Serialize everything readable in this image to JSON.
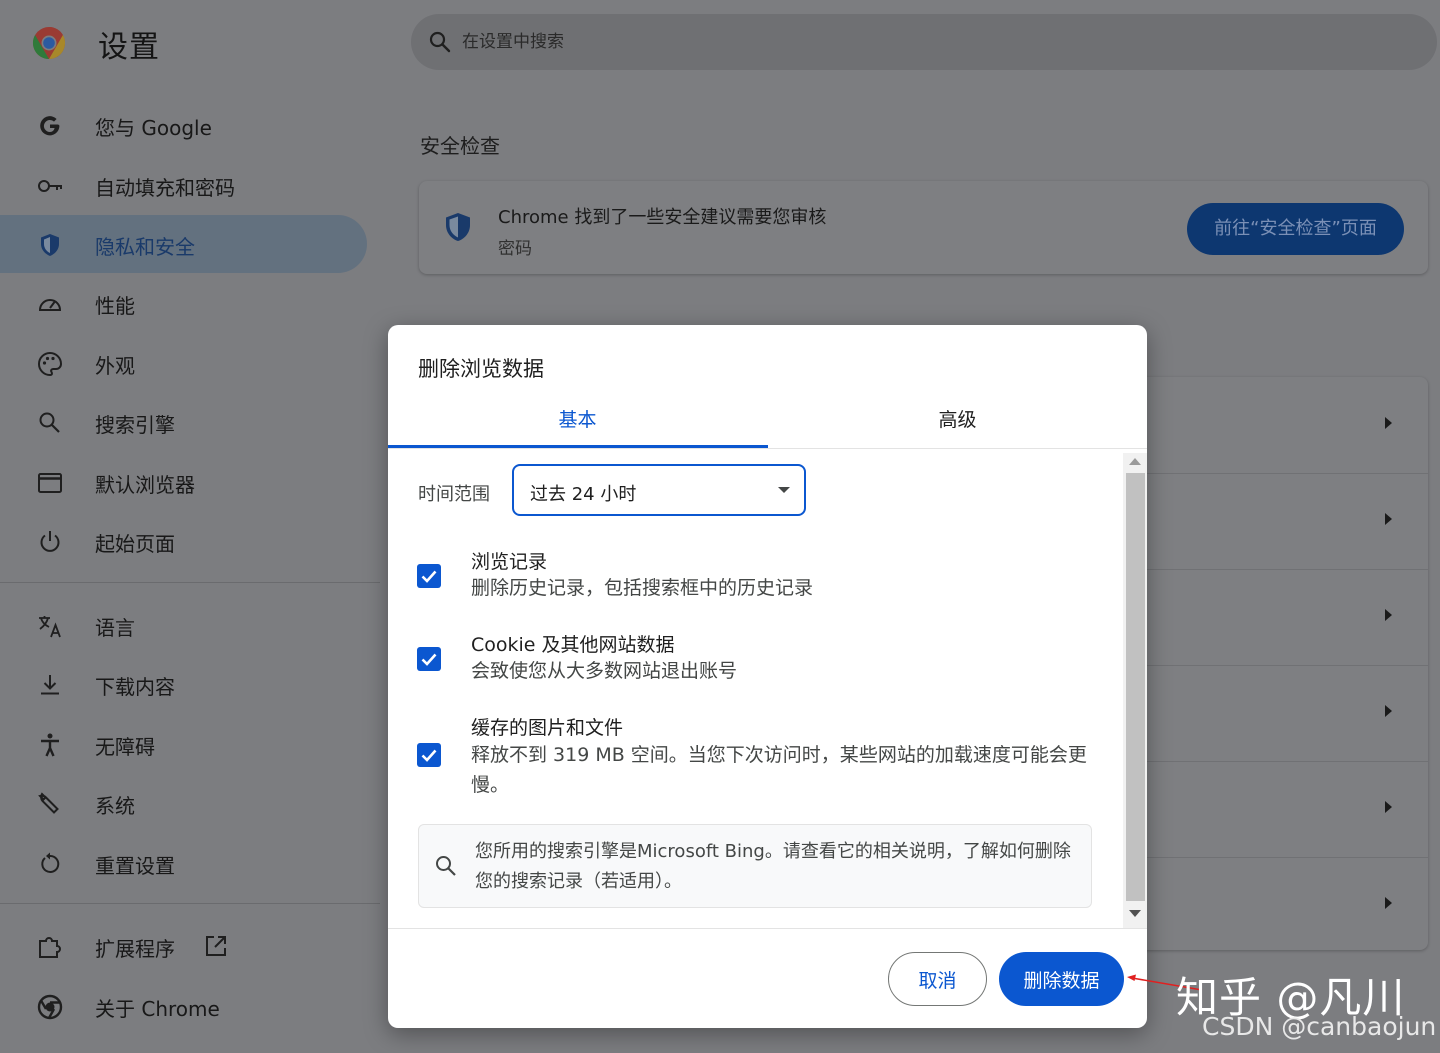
{
  "header": {
    "title": "设置",
    "search_placeholder": "在设置中搜索"
  },
  "sidebar": {
    "items": [
      {
        "label": "您与 Google",
        "icon": "google-icon"
      },
      {
        "label": "自动填充和密码",
        "icon": "key-icon"
      },
      {
        "label": "隐私和安全",
        "icon": "shield-icon",
        "active": true
      },
      {
        "label": "性能",
        "icon": "gauge-icon"
      },
      {
        "label": "外观",
        "icon": "palette-icon"
      },
      {
        "label": "搜索引擎",
        "icon": "search-icon"
      },
      {
        "label": "默认浏览器",
        "icon": "browser-window-icon"
      },
      {
        "label": "起始页面",
        "icon": "power-icon"
      },
      {
        "label": "语言",
        "icon": "translate-icon"
      },
      {
        "label": "下载内容",
        "icon": "download-icon"
      },
      {
        "label": "无障碍",
        "icon": "accessibility-icon"
      },
      {
        "label": "系统",
        "icon": "wrench-icon"
      },
      {
        "label": "重置设置",
        "icon": "reset-icon"
      },
      {
        "label": "扩展程序",
        "icon": "puzzle-icon"
      },
      {
        "label": "关于 Chrome",
        "icon": "chrome-icon"
      }
    ]
  },
  "main": {
    "section_title": "安全检查",
    "safety_card": {
      "title": "Chrome 找到了一些安全建议需要您审核",
      "subtitle": "密码",
      "button_label": "前往“安全检查”页面"
    }
  },
  "dialog": {
    "title": "删除浏览数据",
    "tabs": [
      {
        "label": "基本",
        "selected": true
      },
      {
        "label": "高级",
        "selected": false
      }
    ],
    "time_range": {
      "label": "时间范围",
      "value": "过去 24 小时"
    },
    "options": [
      {
        "title": "浏览记录",
        "description": "删除历史记录，包括搜索框中的历史记录",
        "checked": true
      },
      {
        "title": "Cookie 及其他网站数据",
        "description": "会致使您从大多数网站退出账号",
        "checked": true
      },
      {
        "title": "缓存的图片和文件",
        "description": "释放不到 319 MB 空间。当您下次访问时，某些网站的加载速度可能会更慢。",
        "checked": true
      }
    ],
    "info_text": "您所用的搜索引擎是Microsoft Bing。请查看它的相关说明，了解如何删除您的搜索记录（若适用）。",
    "cancel_label": "取消",
    "delete_label": "删除数据"
  },
  "watermarks": {
    "zhihu": "知乎 @凡川",
    "csdn": "CSDN @canbaojun"
  },
  "colors": {
    "accent": "#0b57d0",
    "overlay_background": "#7c7d80",
    "annotation_arrow": "#e02020"
  }
}
